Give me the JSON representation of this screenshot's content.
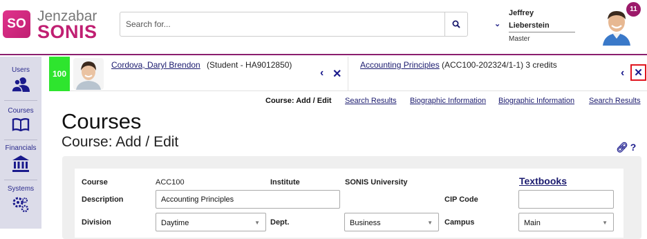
{
  "header": {
    "logo_initials": "SO",
    "logo_brand": "Jenzabar",
    "logo_product": "SONIS",
    "search_placeholder": "Search for...",
    "user_first": "Jeffrey",
    "user_last": "Lieberstein",
    "user_role": "Master",
    "notification_count": "11"
  },
  "sidebar": {
    "items": [
      {
        "label": "Users",
        "icon": "users-icon"
      },
      {
        "label": "Courses",
        "icon": "book-icon"
      },
      {
        "label": "Financials",
        "icon": "bank-icon"
      },
      {
        "label": "Systems",
        "icon": "gears-icon"
      }
    ]
  },
  "context": {
    "student_score": "100",
    "student_name": "Cordova, Daryl Brendon",
    "student_meta": "(Student - HA9012850)",
    "course_name": "Accounting Principles",
    "course_meta": "(ACC100-202324/1-1) 3 credits"
  },
  "breadcrumb": {
    "current": "Course: Add / Edit",
    "links": [
      "Search Results",
      "Biographic Information",
      "Biographic Information",
      "Search Results"
    ]
  },
  "page": {
    "title": "Courses",
    "subtitle": "Course: Add / Edit"
  },
  "form": {
    "course_label": "Course",
    "course_value": "ACC100",
    "institute_label": "Institute",
    "institute_value": "SONIS University",
    "textbooks_link": "Textbooks",
    "description_label": "Description",
    "description_value": "Accounting Principles",
    "cip_label": "CIP Code",
    "cip_value": "",
    "division_label": "Division",
    "division_value": "Daytime",
    "dept_label": "Dept.",
    "dept_value": "Business",
    "campus_label": "Campus",
    "campus_value": "Main"
  },
  "colors": {
    "brand": "#c01f72",
    "accent_nav": "#1a1a8c",
    "score_green": "#2ee52e",
    "highlight_red": "#e0141e",
    "sidebar_bg": "#dcdce9"
  }
}
